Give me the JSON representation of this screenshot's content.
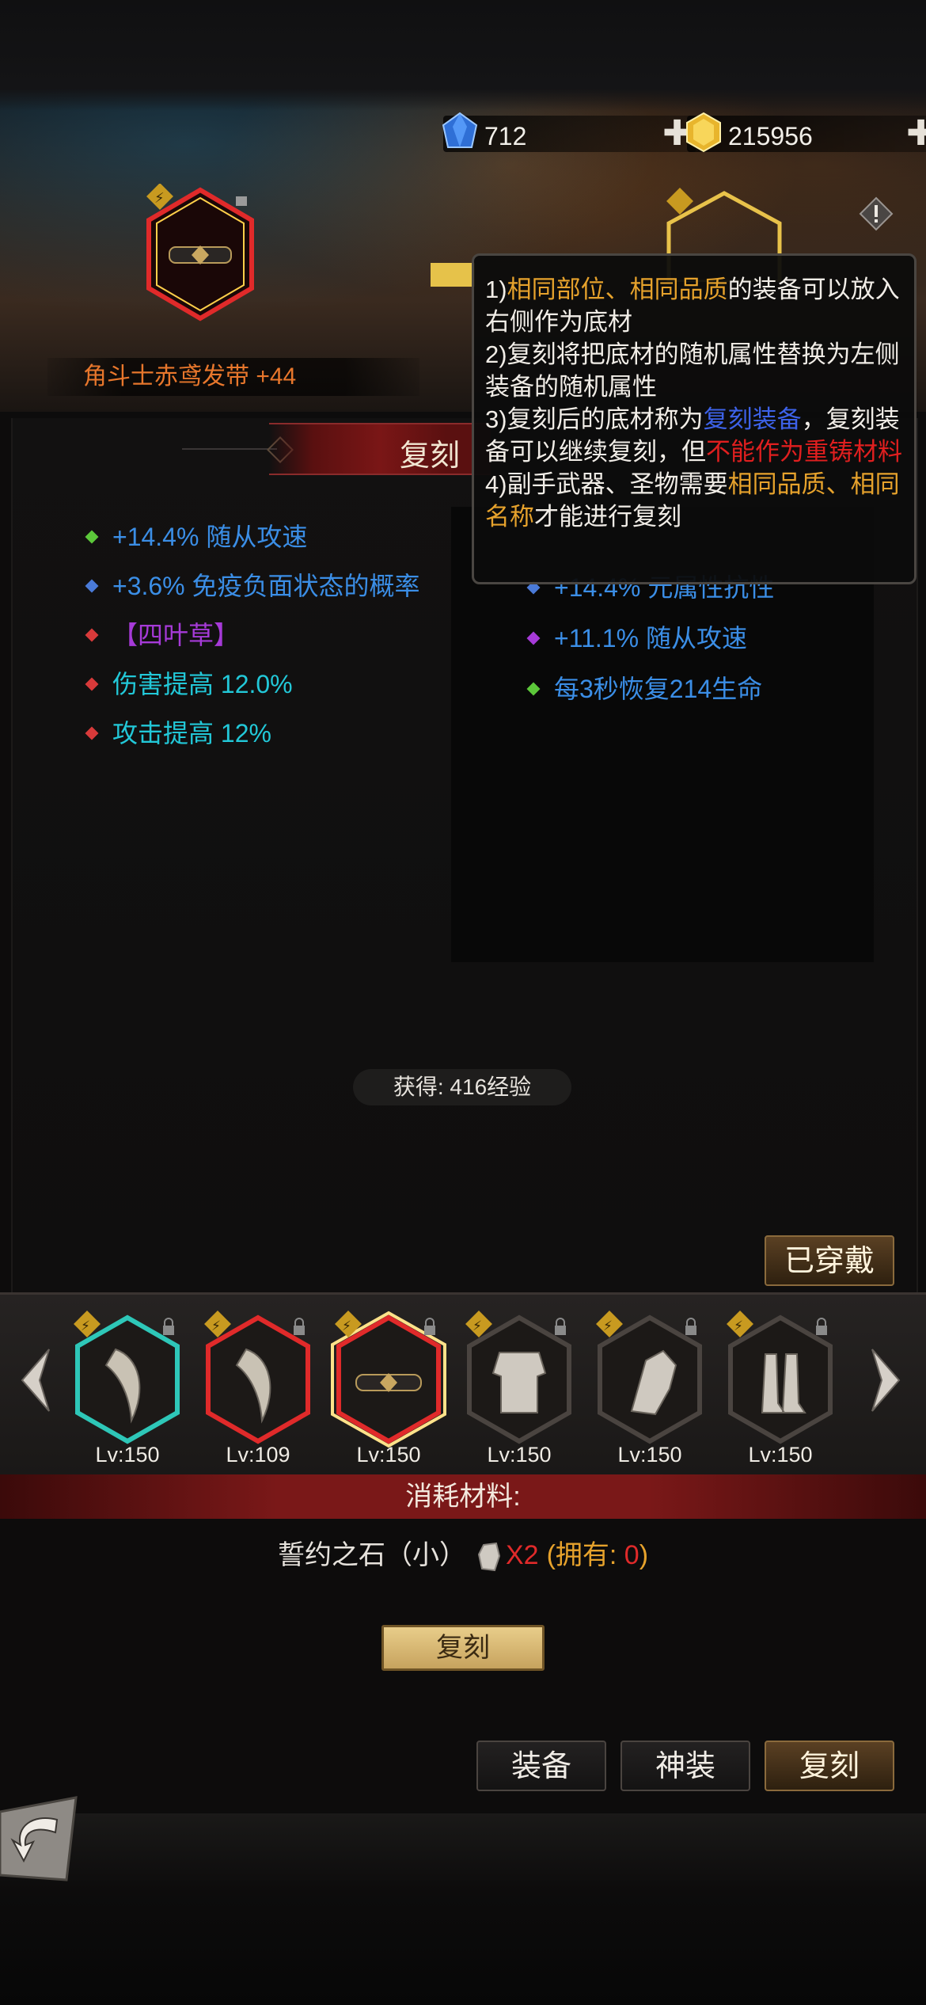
{
  "currencies": [
    {
      "name": "diamond-icon",
      "value": "712",
      "color": "#3a7bd8"
    },
    {
      "name": "gold-gem-icon",
      "value": "215956",
      "color": "#e8b52c"
    }
  ],
  "left_item": {
    "name": "角斗士赤鸢发带 +44",
    "name_color": "#e8772c"
  },
  "panel_title": "复刻",
  "left_attributes": [
    {
      "text": "+14.4% 随从攻速",
      "color": "#3b8ee6",
      "bullet": "#5cc83a"
    },
    {
      "text": "+3.6% 免疫负面状态的概率",
      "color": "#3b8ee6",
      "bullet": "#4a7ad8"
    },
    {
      "text": "【四叶草】",
      "color": "#a63ad8",
      "bullet": "#d83a3a"
    },
    {
      "text": "伤害提高 12.0%",
      "color": "#22c8d8",
      "bullet": "#d83a3a"
    },
    {
      "text": "攻击提高 12%",
      "color": "#22c8d8",
      "bullet": "#d83a3a"
    }
  ],
  "right_attributes": [
    {
      "text": "+14.4% 元属性抗性",
      "color": "#3b8ee6",
      "bullet": "#4a7ad8"
    },
    {
      "text": "+11.1% 随从攻速",
      "color": "#3b8ee6",
      "bullet": "#a63ad8"
    },
    {
      "text": "每3秒恢复214生命",
      "color": "#3b8ee6",
      "bullet": "#5cc83a"
    }
  ],
  "exp_text": "获得: 416经验",
  "equipped_label": "已穿戴",
  "equipment_slots": [
    {
      "lv": "Lv:150",
      "frame": "#2ec7b8",
      "icon": "horn-icon"
    },
    {
      "lv": "Lv:109",
      "frame": "#e02a2a",
      "icon": "horn-icon"
    },
    {
      "lv": "Lv:150",
      "frame": "#e02a2a",
      "icon": "headband-icon"
    },
    {
      "lv": "Lv:150",
      "frame": "#4a4440",
      "icon": "armor-icon"
    },
    {
      "lv": "Lv:150",
      "frame": "#4a4440",
      "icon": "gauntlet-icon"
    },
    {
      "lv": "Lv:150",
      "frame": "#4a4440",
      "icon": "boots-icon"
    }
  ],
  "consume_title": "消耗材料:",
  "material": {
    "name": "誓约之石（小）",
    "qty": "X2",
    "own_prefix": "(拥有: ",
    "own_value": "0",
    "own_suffix": ")"
  },
  "action_button": "复刻",
  "tabs": [
    "装备",
    "神装",
    "复刻"
  ],
  "tooltip": {
    "lines": [
      [
        {
          "t": "1)",
          "c": ""
        },
        {
          "t": "相同部位、相同品质",
          "c": "o"
        },
        {
          "t": "的装备可以放入右侧作为底材",
          "c": ""
        }
      ],
      [
        {
          "t": "2)复刻将把底材的随机属性替换为左侧装备的随机属性",
          "c": ""
        }
      ],
      [
        {
          "t": "3)复刻后的底材称为",
          "c": ""
        },
        {
          "t": "复刻装备",
          "c": "b"
        },
        {
          "t": "，复刻装备可以继续复刻，但",
          "c": ""
        },
        {
          "t": "不能作为重铸材料",
          "c": "r"
        }
      ],
      [
        {
          "t": "4)副手武器、圣物需要",
          "c": ""
        },
        {
          "t": "相同品质、相同名称",
          "c": "o"
        },
        {
          "t": "才能进行复刻",
          "c": ""
        }
      ]
    ]
  }
}
